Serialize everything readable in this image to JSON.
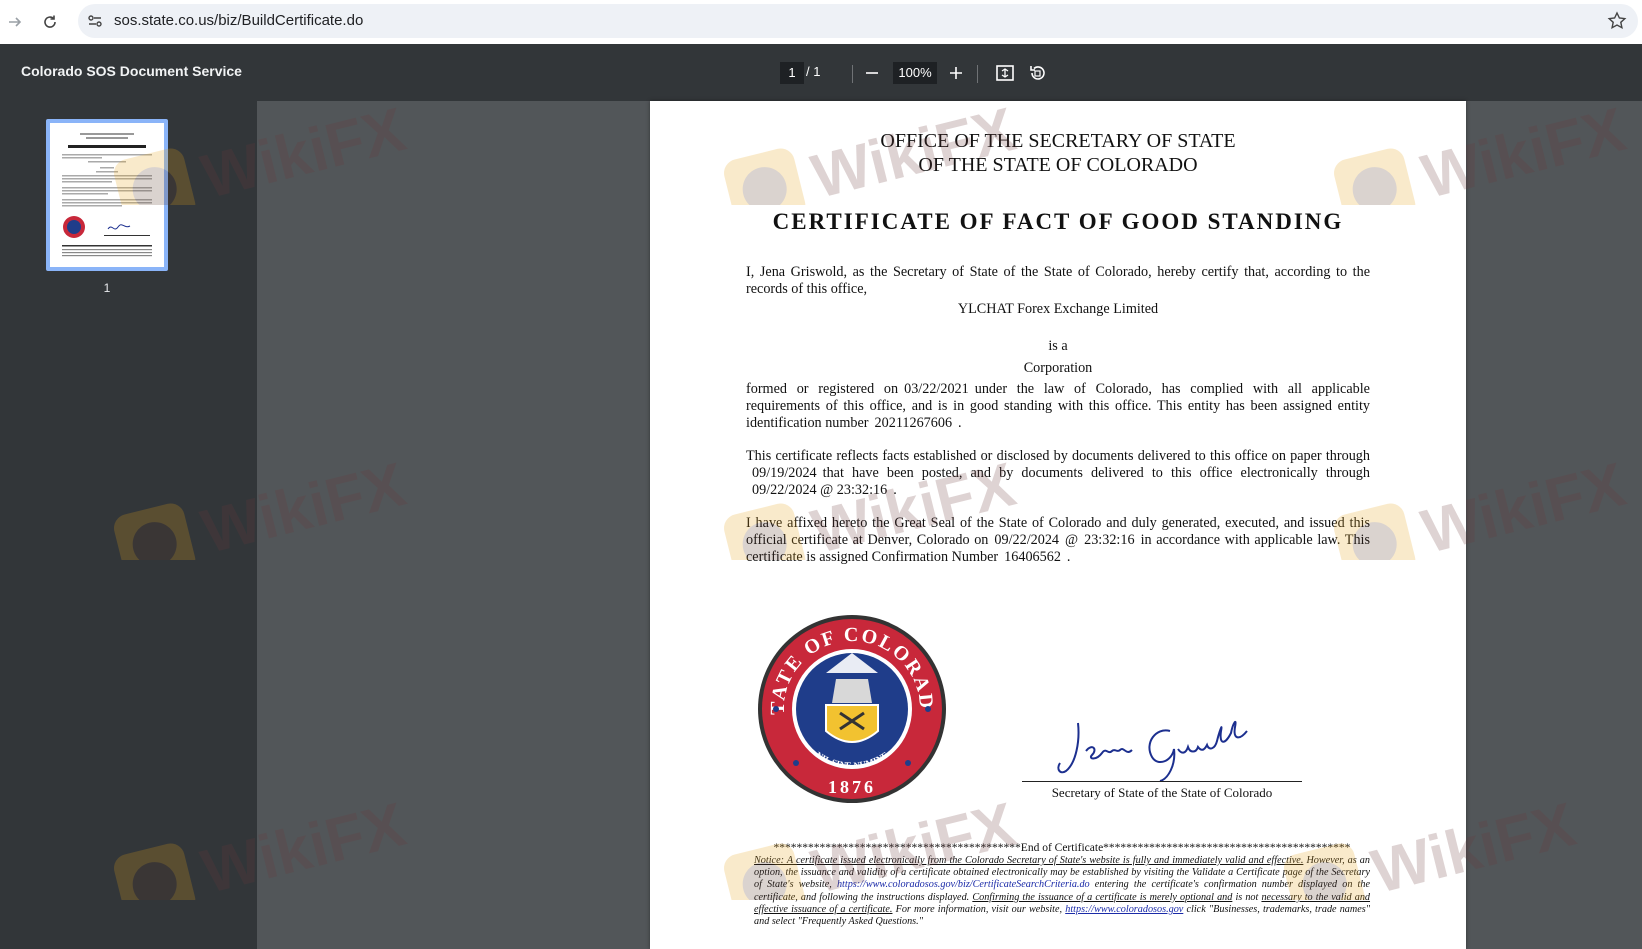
{
  "browser": {
    "url": "sos.state.co.us/biz/BuildCertificate.do"
  },
  "toolbar": {
    "title": "Colorado SOS Document Service",
    "current_page": "1",
    "page_total": "/  1",
    "zoom": "100%"
  },
  "sidebar": {
    "thumbnail_label": "1"
  },
  "document": {
    "office_line1": "OFFICE OF THE SECRETARY OF STATE",
    "office_line2": "OF THE STATE OF COLORADO",
    "title": "CERTIFICATE OF FACT OF GOOD STANDING",
    "intro": "I, Jena Griswold, as the Secretary of State of the State of Colorado, hereby certify that, according to the records of this office,",
    "entity_name": "YLCHAT Forex Exchange Limited",
    "is_a": "is a",
    "entity_type": "Corporation",
    "p1_a": "formed or registered on",
    "formed_date": "03/22/2021",
    "p1_b": "under the law of Colorado, has complied with all applicable requirements of this office, and is in good standing with this office.  This entity has been assigned entity identification number",
    "entity_id": "20211267606",
    "p1_end": ".",
    "p2_a": "This certificate reflects facts established or disclosed by documents delivered to this office on paper through",
    "paper_date": "09/19/2024",
    "p2_b": "that have been posted, and by documents delivered to this office electronically through",
    "electronic_date": "09/22/2024 @ 23:32:16",
    "p2_end": ".",
    "p3_a": "I have affixed hereto the Great Seal of the State of Colorado and duly generated, executed, and issued this official certificate at Denver, Colorado on",
    "issue_date": "09/22/2024",
    "issue_at": "@",
    "issue_time": "23:32:16",
    "p3_b": "in accordance with applicable law. This certificate is assigned Confirmation Number",
    "confirmation_number": "16406562",
    "p3_end": ".",
    "seal_top": "STATE OF COLORADO",
    "seal_motto": "NIL SINE NUMINE",
    "seal_year": "1876",
    "signature_label": "Secretary of State of the State of Colorado",
    "end_of_certificate": "*******************************************End of Certificate*******************************************",
    "notice_1": "Notice: A certificate issued electronically from the Colorado Secretary of State's website is fully and immediately valid and effective.",
    "notice_2": "However, as an option, the issuance and validity of a certificate obtained electronically may be established by visiting the Validate a Certificate page of the Secretary of State's website,",
    "notice_link1": "https://www.coloradosos.gov/biz/CertificateSearchCriteria.do",
    "notice_3": "entering the certificate's confirmation number displayed on the certificate, and following the instructions displayed.",
    "notice_4": "Confirming the issuance of a certificate is merely optional and",
    "notice_5": "is not",
    "notice_6": "necessary to the valid and effective issuance of a certificate.",
    "notice_7": "For more information, visit our website,",
    "notice_link2": "https://www.coloradosos.gov",
    "notice_8": "click \"Businesses, trademarks, trade names\" and select \"Frequently Asked Questions.\""
  },
  "watermark": {
    "text": "WikiFX"
  },
  "colors": {
    "toolbar_bg": "#323639",
    "viewer_bg": "#525659",
    "thumb_border": "#8ab4f8",
    "seal_red": "#c8283a",
    "seal_blue": "#1f3d8a",
    "signature_blue": "#1c2f8f"
  }
}
